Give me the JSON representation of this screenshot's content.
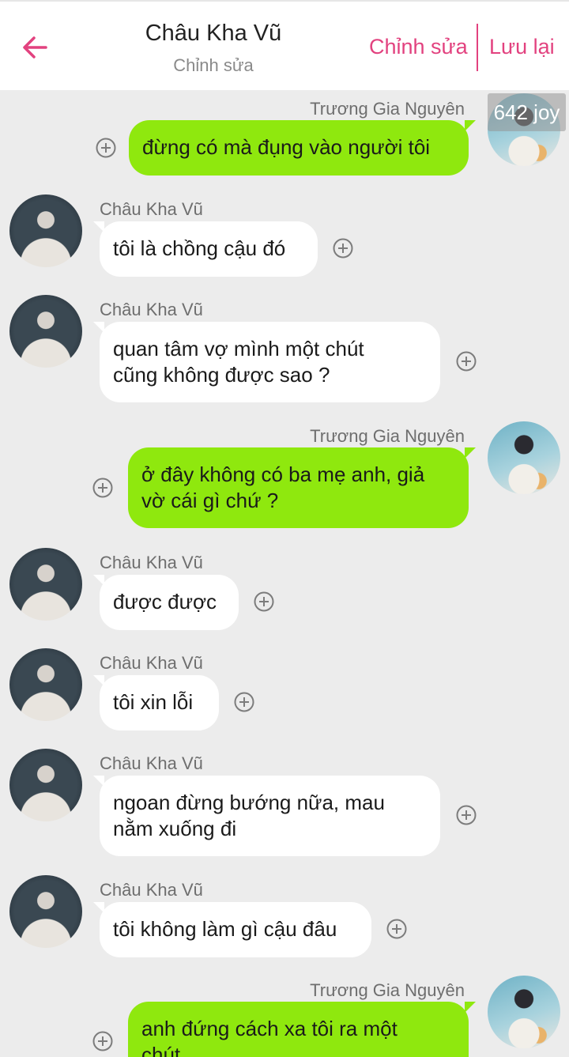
{
  "header": {
    "title": "Châu Kha Vũ",
    "subtitle": "Chỉnh sửa",
    "edit_label": "Chỉnh sửa",
    "save_label": "Lưu lại",
    "accent_color": "#e2427f"
  },
  "watermark": "642 joy",
  "messages": [
    {
      "sender": "Trương Gia Nguyên",
      "side": "right",
      "text": [
        "đừng có mà đụng vào người tôi"
      ]
    },
    {
      "sender": "Châu Kha Vũ",
      "side": "left",
      "text": [
        "tôi là chồng cậu đó"
      ]
    },
    {
      "sender": "Châu Kha Vũ",
      "side": "left",
      "text": [
        "quan tâm vợ mình một chút",
        "cũng không được sao ?"
      ]
    },
    {
      "sender": "Trương Gia Nguyên",
      "side": "right",
      "text": [
        "ở đây không có ba mẹ anh, giả",
        "vờ cái gì chứ ?"
      ]
    },
    {
      "sender": "Châu Kha Vũ",
      "side": "left",
      "text": [
        "được được"
      ]
    },
    {
      "sender": "Châu Kha Vũ",
      "side": "left",
      "text": [
        "tôi xin lỗi"
      ]
    },
    {
      "sender": "Châu Kha Vũ",
      "side": "left",
      "text": [
        "ngoan đừng bướng nữa, mau",
        "nằm xuống đi"
      ]
    },
    {
      "sender": "Châu Kha Vũ",
      "side": "left",
      "text": [
        "tôi không làm gì cậu đâu"
      ]
    },
    {
      "sender": "Trương Gia Nguyên",
      "side": "right",
      "text": [
        "anh đứng cách xa tôi ra một",
        "chút"
      ]
    }
  ],
  "colors": {
    "outgoing_bubble": "#8fe80e",
    "incoming_bubble": "#ffffff",
    "background": "#ececec"
  },
  "icons": {
    "back": "arrow-left-icon",
    "add": "circle-plus-icon"
  }
}
